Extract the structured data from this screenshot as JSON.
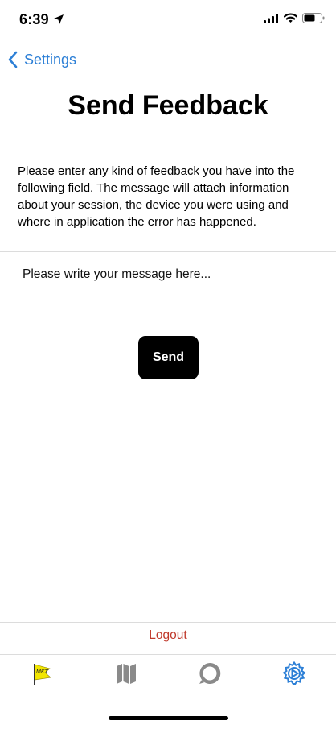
{
  "status_bar": {
    "time": "6:39",
    "location_icon": "location-arrow-icon",
    "signal_icon": "cellular-signal-icon",
    "wifi_icon": "wifi-icon",
    "battery_icon": "battery-icon"
  },
  "nav": {
    "back_label": "Settings",
    "back_icon": "chevron-left-icon",
    "accent_color": "#2c7fd6"
  },
  "page": {
    "title": "Send Feedback",
    "description": "Please enter any kind of feedback you have into the following field. The message will attach information about your session, the device you were using and where in application the error has happened."
  },
  "form": {
    "message_placeholder": "Please write your message here...",
    "message_value": "",
    "send_label": "Send"
  },
  "footer": {
    "logout_label": "Logout",
    "logout_color": "#c0392b"
  },
  "tabs": [
    {
      "name": "tab-flag",
      "icon": "flag-icon",
      "flag_text": "MKT",
      "selected": false
    },
    {
      "name": "tab-map",
      "icon": "map-icon",
      "selected": false
    },
    {
      "name": "tab-messages",
      "icon": "chat-bubble-icon",
      "selected": false
    },
    {
      "name": "tab-settings",
      "icon": "gear-icon",
      "selected": true
    }
  ]
}
